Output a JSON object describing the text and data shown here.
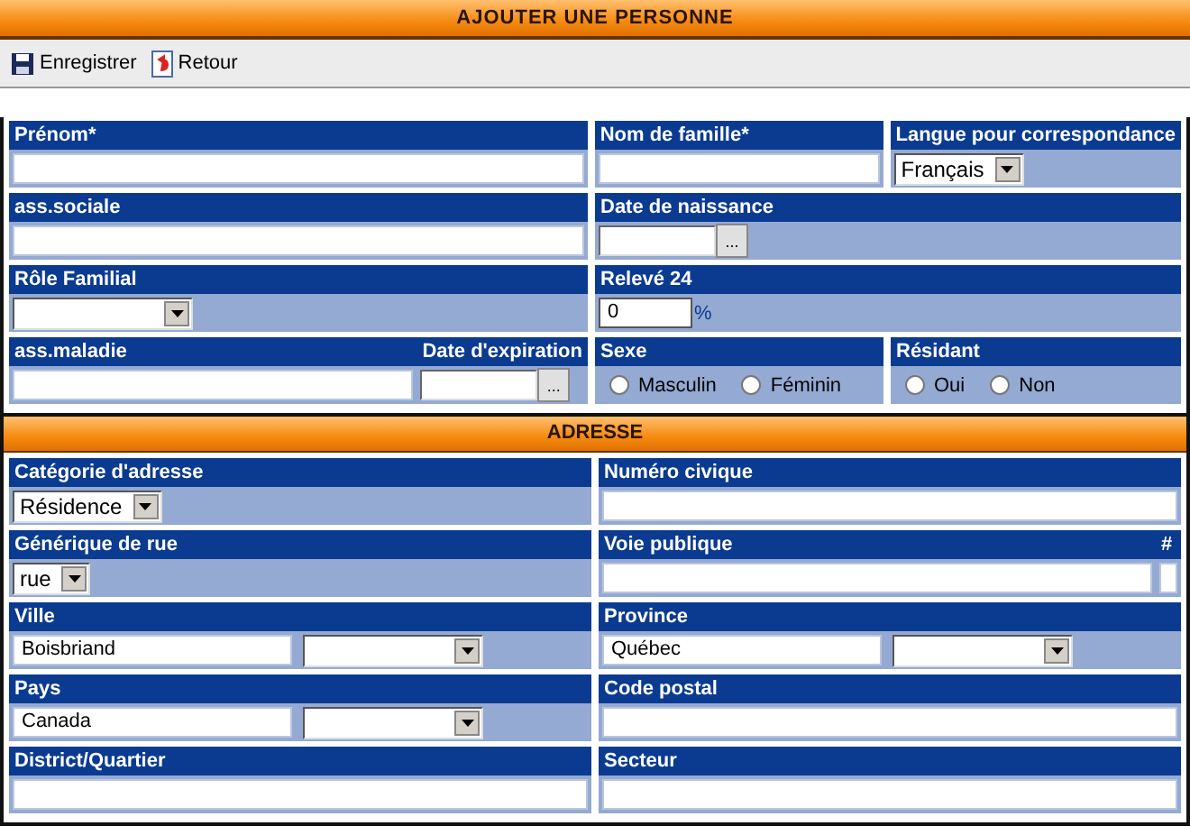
{
  "title": "AJOUTER UNE PERSONNE",
  "toolbar": [
    {
      "label": "Enregistrer",
      "kind": "save"
    },
    {
      "label": "Retour",
      "kind": "back"
    }
  ],
  "sections": [
    {
      "rows": [
        {
          "cells": [
            {
              "parts": [
                {
                  "label": "Prénom*",
                  "controls": [
                    {
                      "kind": "text"
                    }
                  ]
                }
              ]
            },
            {
              "parts": [
                {
                  "label": "Nom de famille*",
                  "controls": [
                    {
                      "kind": "text"
                    }
                  ]
                }
              ]
            },
            {
              "parts": [
                {
                  "label": "Langue pour correspondance",
                  "controls": [
                    {
                      "kind": "select",
                      "value": "Français"
                    }
                  ]
                }
              ]
            }
          ]
        },
        {
          "cells": [
            {
              "parts": [
                {
                  "label": "ass.sociale",
                  "controls": [
                    {
                      "kind": "text"
                    }
                  ]
                }
              ]
            },
            {
              "parts": [
                {
                  "label": "Date de naissance",
                  "controls": [
                    {
                      "kind": "date",
                      "button_label": "..."
                    }
                  ]
                }
              ]
            }
          ]
        },
        {
          "cells": [
            {
              "parts": [
                {
                  "label": "Rôle Familial",
                  "controls": [
                    {
                      "kind": "select"
                    }
                  ]
                }
              ]
            },
            {
              "parts": [
                {
                  "label": "Relevé 24",
                  "controls": [
                    {
                      "kind": "percent",
                      "value": "0",
                      "unit": "%"
                    }
                  ]
                }
              ]
            }
          ]
        },
        {
          "cells": [
            {
              "parts": [
                {
                  "label": "ass.maladie",
                  "controls": [
                    {
                      "kind": "text"
                    }
                  ]
                },
                {
                  "label": "Date d'expiration",
                  "controls": [
                    {
                      "kind": "date",
                      "button_label": "..."
                    }
                  ]
                }
              ]
            },
            {
              "parts": [
                {
                  "label": "Sexe",
                  "controls": [
                    {
                      "kind": "radio",
                      "options": [
                        {
                          "label": "Masculin",
                          "selected": false
                        },
                        {
                          "label": "Féminin",
                          "selected": false
                        }
                      ]
                    }
                  ]
                }
              ]
            },
            {
              "parts": [
                {
                  "label": "Résidant",
                  "controls": [
                    {
                      "kind": "radio",
                      "options": [
                        {
                          "label": "Oui",
                          "selected": false
                        },
                        {
                          "label": "Non",
                          "selected": false
                        }
                      ]
                    }
                  ]
                }
              ]
            }
          ]
        }
      ]
    },
    {
      "title": "ADRESSE",
      "rows": [
        {
          "cells": [
            {
              "parts": [
                {
                  "label": "Catégorie d'adresse",
                  "controls": [
                    {
                      "kind": "select",
                      "value": "Résidence"
                    }
                  ]
                }
              ]
            },
            {
              "parts": [
                {
                  "label": "Numéro civique",
                  "controls": [
                    {
                      "kind": "text"
                    }
                  ]
                }
              ]
            }
          ]
        },
        {
          "cells": [
            {
              "parts": [
                {
                  "label": "Générique de rue",
                  "controls": [
                    {
                      "kind": "select",
                      "value": "rue"
                    }
                  ]
                }
              ]
            },
            {
              "parts": [
                {
                  "label": "Voie publique",
                  "controls": [
                    {
                      "kind": "text"
                    }
                  ]
                },
                {
                  "label": "#",
                  "controls": [
                    {
                      "kind": "text"
                    }
                  ]
                }
              ]
            }
          ]
        },
        {
          "cells": [
            {
              "parts": [
                {
                  "label": "Ville",
                  "controls": [
                    {
                      "kind": "text",
                      "value": "Boisbriand"
                    },
                    {
                      "kind": "select"
                    }
                  ]
                }
              ]
            },
            {
              "parts": [
                {
                  "label": "Province",
                  "controls": [
                    {
                      "kind": "text",
                      "value": "Québec"
                    },
                    {
                      "kind": "select"
                    }
                  ]
                }
              ]
            }
          ]
        },
        {
          "cells": [
            {
              "parts": [
                {
                  "label": "Pays",
                  "controls": [
                    {
                      "kind": "text",
                      "value": "Canada"
                    },
                    {
                      "kind": "select"
                    }
                  ]
                }
              ]
            },
            {
              "parts": [
                {
                  "label": "Code postal",
                  "controls": [
                    {
                      "kind": "text"
                    }
                  ]
                }
              ]
            }
          ]
        },
        {
          "cells": [
            {
              "parts": [
                {
                  "label": "District/Quartier",
                  "controls": [
                    {
                      "kind": "text"
                    }
                  ]
                }
              ]
            },
            {
              "parts": [
                {
                  "label": "Secteur",
                  "controls": [
                    {
                      "kind": "text"
                    }
                  ]
                }
              ]
            }
          ]
        }
      ]
    }
  ]
}
